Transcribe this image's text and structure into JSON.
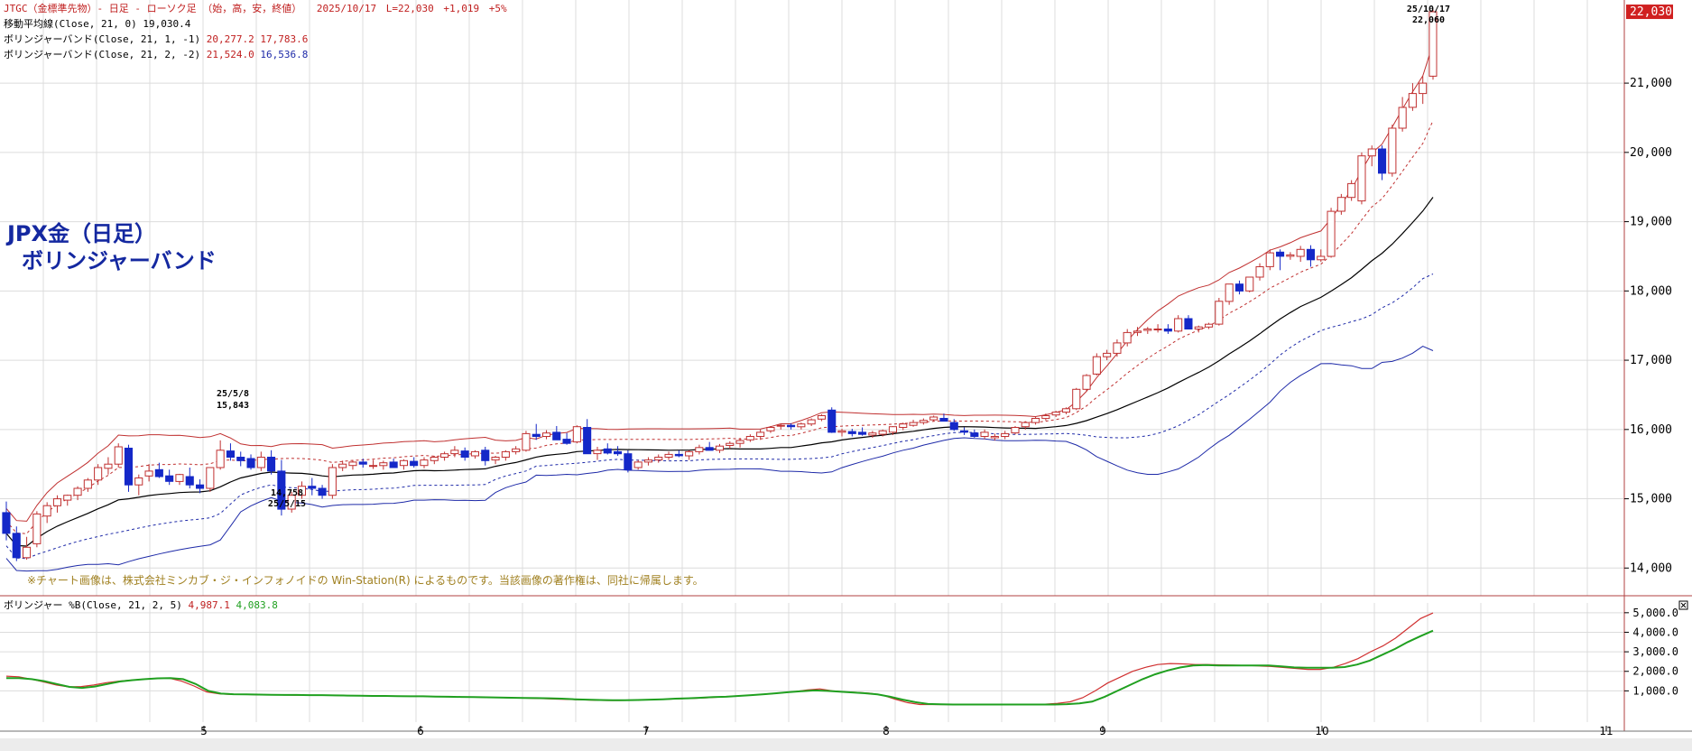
{
  "header": {
    "line1": {
      "symbol": "JTGC（金標準先物）- 日足 - ローソク足 （始，高，安，終値）",
      "date": "2025/10/17",
      "last": "L=22,030",
      "change": "+1,019",
      "limit": "+5%"
    },
    "line2": {
      "label": "移動平均線(Close, 21, 0)",
      "value": "19,030.4"
    },
    "line3": {
      "label": "ボリンジャーバンド(Close, 21, 1, -1)",
      "upper": "20,277.2",
      "lower": "17,783.6"
    },
    "line4": {
      "label": "ボリンジャーバンド(Close, 21, 2, -2)",
      "upper": "21,524.0",
      "lower": "16,536.8"
    }
  },
  "title_line1": "JPX金（日足）",
  "title_line2": "ボリンジャーバンド",
  "credit": "※チャート画像は、株式会社ミンカブ・ジ・インフォノイドの Win-Station(R) によるものです。当該画像の著作権は、同社に帰属します。",
  "colors": {
    "bull": "#c03030",
    "bear": "#1428c8",
    "ma": "#000000",
    "band1": "#c03030",
    "band2": "#1e2aa8",
    "pb_red": "#d03030",
    "pb_green": "#20a020",
    "last_price_bg": "#d02020",
    "grid": "#dcdcdc",
    "frame": "#b04040"
  },
  "chart_data": {
    "type": "candlestick",
    "y_axis": {
      "ticks": [
        "14,000",
        "15,000",
        "16,000",
        "17,000",
        "18,000",
        "19,000",
        "20,000",
        "21,000"
      ],
      "range": [
        13600,
        22200
      ],
      "last_price_label": "22,030"
    },
    "x_axis": {
      "ticks": [
        "5",
        "6",
        "7",
        "8",
        "9",
        "10",
        "11"
      ]
    },
    "annotations": [
      {
        "date": "25/5/8",
        "value": "15,843"
      },
      {
        "date": "25/5/15",
        "value": "14,758"
      },
      {
        "date": "25/10/17",
        "value": "22,060"
      }
    ],
    "candles": [
      [
        14800,
        14960,
        14400,
        14500
      ],
      [
        14500,
        14600,
        14100,
        14150
      ],
      [
        14150,
        14450,
        14120,
        14300
      ],
      [
        14350,
        14820,
        14300,
        14780
      ],
      [
        14750,
        14950,
        14650,
        14900
      ],
      [
        14900,
        15050,
        14800,
        15000
      ],
      [
        14980,
        15060,
        14900,
        15050
      ],
      [
        15050,
        15180,
        14980,
        15150
      ],
      [
        15150,
        15300,
        15100,
        15270
      ],
      [
        15270,
        15500,
        15200,
        15450
      ],
      [
        15440,
        15600,
        15350,
        15500
      ],
      [
        15500,
        15800,
        15450,
        15750
      ],
      [
        15730,
        15780,
        15100,
        15200
      ],
      [
        15200,
        15350,
        15050,
        15300
      ],
      [
        15330,
        15500,
        15250,
        15400
      ],
      [
        15420,
        15520,
        15300,
        15320
      ],
      [
        15330,
        15420,
        15200,
        15250
      ],
      [
        15250,
        15360,
        15200,
        15350
      ],
      [
        15320,
        15450,
        15150,
        15200
      ],
      [
        15200,
        15280,
        15080,
        15150
      ],
      [
        15150,
        15450,
        15100,
        15450
      ],
      [
        15450,
        15843,
        15420,
        15700
      ],
      [
        15690,
        15800,
        15550,
        15600
      ],
      [
        15600,
        15680,
        15470,
        15550
      ],
      [
        15580,
        15640,
        15420,
        15450
      ],
      [
        15450,
        15680,
        15400,
        15600
      ],
      [
        15600,
        15700,
        15350,
        15400
      ],
      [
        15400,
        15560,
        14758,
        14850
      ],
      [
        14850,
        15100,
        14800,
        15050
      ],
      [
        15050,
        15250,
        15000,
        15180
      ],
      [
        15180,
        15300,
        15050,
        15150
      ],
      [
        15150,
        15200,
        15000,
        15050
      ],
      [
        15050,
        15500,
        15000,
        15450
      ],
      [
        15450,
        15550,
        15400,
        15500
      ],
      [
        15480,
        15560,
        15420,
        15530
      ],
      [
        15530,
        15580,
        15450,
        15500
      ],
      [
        15470,
        15560,
        15430,
        15480
      ],
      [
        15480,
        15550,
        15420,
        15520
      ],
      [
        15530,
        15580,
        15450,
        15450
      ],
      [
        15480,
        15570,
        15420,
        15550
      ],
      [
        15540,
        15600,
        15450,
        15480
      ],
      [
        15480,
        15600,
        15440,
        15560
      ],
      [
        15550,
        15620,
        15500,
        15600
      ],
      [
        15600,
        15680,
        15550,
        15650
      ],
      [
        15650,
        15760,
        15600,
        15700
      ],
      [
        15690,
        15740,
        15550,
        15600
      ],
      [
        15620,
        15700,
        15580,
        15680
      ],
      [
        15700,
        15750,
        15480,
        15550
      ],
      [
        15560,
        15620,
        15500,
        15600
      ],
      [
        15600,
        15700,
        15550,
        15680
      ],
      [
        15680,
        15760,
        15640,
        15720
      ],
      [
        15700,
        15980,
        15680,
        15940
      ],
      [
        15930,
        16080,
        15850,
        15900
      ],
      [
        15900,
        15990,
        15860,
        15950
      ],
      [
        15960,
        16050,
        15850,
        15850
      ],
      [
        15860,
        15950,
        15780,
        15800
      ],
      [
        15820,
        16060,
        15800,
        16040
      ],
      [
        16030,
        16150,
        15650,
        15650
      ],
      [
        15650,
        15750,
        15560,
        15700
      ],
      [
        15720,
        15800,
        15640,
        15660
      ],
      [
        15680,
        15760,
        15620,
        15650
      ],
      [
        15650,
        15700,
        15380,
        15420
      ],
      [
        15450,
        15560,
        15420,
        15530
      ],
      [
        15530,
        15600,
        15480,
        15560
      ],
      [
        15560,
        15640,
        15520,
        15600
      ],
      [
        15600,
        15680,
        15560,
        15640
      ],
      [
        15640,
        15700,
        15600,
        15620
      ],
      [
        15620,
        15700,
        15560,
        15680
      ],
      [
        15680,
        15780,
        15640,
        15740
      ],
      [
        15740,
        15820,
        15700,
        15700
      ],
      [
        15700,
        15790,
        15660,
        15760
      ],
      [
        15770,
        15830,
        15720,
        15800
      ],
      [
        15800,
        15880,
        15740,
        15840
      ],
      [
        15850,
        15930,
        15820,
        15900
      ],
      [
        15900,
        16000,
        15850,
        15960
      ],
      [
        15980,
        16050,
        15950,
        16030
      ],
      [
        16050,
        16080,
        16000,
        16060
      ],
      [
        16060,
        16090,
        16000,
        16040
      ],
      [
        16040,
        16100,
        16000,
        16080
      ],
      [
        16080,
        16160,
        16050,
        16140
      ],
      [
        16150,
        16220,
        16120,
        16200
      ],
      [
        16280,
        16320,
        15950,
        15960
      ],
      [
        15960,
        16010,
        15900,
        15980
      ],
      [
        15970,
        16010,
        15900,
        15940
      ],
      [
        15960,
        16030,
        15910,
        15930
      ],
      [
        15920,
        15980,
        15880,
        15950
      ],
      [
        15930,
        16000,
        15900,
        15980
      ],
      [
        15960,
        16050,
        15920,
        16040
      ],
      [
        16030,
        16100,
        15990,
        16080
      ],
      [
        16060,
        16140,
        16040,
        16100
      ],
      [
        16100,
        16160,
        16070,
        16130
      ],
      [
        16140,
        16200,
        16120,
        16180
      ],
      [
        16160,
        16230,
        16130,
        16120
      ],
      [
        16100,
        16150,
        15980,
        16000
      ],
      [
        15980,
        16030,
        15920,
        15960
      ],
      [
        15950,
        16000,
        15880,
        15900
      ],
      [
        15900,
        16000,
        15860,
        15960
      ],
      [
        15880,
        15940,
        15840,
        15900
      ],
      [
        15900,
        15980,
        15860,
        15940
      ],
      [
        15950,
        16050,
        15930,
        16030
      ],
      [
        16040,
        16120,
        16000,
        16100
      ],
      [
        16100,
        16180,
        16070,
        16160
      ],
      [
        16160,
        16230,
        16130,
        16200
      ],
      [
        16210,
        16270,
        16180,
        16250
      ],
      [
        16250,
        16320,
        16220,
        16300
      ],
      [
        16300,
        16600,
        16280,
        16580
      ],
      [
        16580,
        16800,
        16550,
        16780
      ],
      [
        16800,
        17100,
        16780,
        17050
      ],
      [
        17050,
        17150,
        17000,
        17100
      ],
      [
        17100,
        17300,
        17050,
        17250
      ],
      [
        17250,
        17450,
        17200,
        17400
      ],
      [
        17400,
        17480,
        17350,
        17420
      ],
      [
        17430,
        17480,
        17380,
        17450
      ],
      [
        17450,
        17520,
        17400,
        17450
      ],
      [
        17450,
        17520,
        17380,
        17420
      ],
      [
        17420,
        17650,
        17400,
        17600
      ],
      [
        17600,
        17650,
        17450,
        17450
      ],
      [
        17450,
        17500,
        17400,
        17480
      ],
      [
        17480,
        17540,
        17450,
        17520
      ],
      [
        17520,
        17900,
        17500,
        17850
      ],
      [
        17850,
        18100,
        17800,
        18100
      ],
      [
        18100,
        18150,
        17950,
        18000
      ],
      [
        18000,
        18200,
        17980,
        18200
      ],
      [
        18200,
        18400,
        18150,
        18350
      ],
      [
        18350,
        18600,
        18300,
        18550
      ],
      [
        18560,
        18600,
        18300,
        18500
      ],
      [
        18500,
        18560,
        18450,
        18520
      ],
      [
        18500,
        18650,
        18420,
        18600
      ],
      [
        18600,
        18660,
        18350,
        18450
      ],
      [
        18450,
        18600,
        18420,
        18500
      ],
      [
        18500,
        19200,
        18480,
        19150
      ],
      [
        19150,
        19400,
        19100,
        19350
      ],
      [
        19350,
        19600,
        19300,
        19550
      ],
      [
        19300,
        20000,
        19250,
        19950
      ],
      [
        19950,
        20100,
        19800,
        20050
      ],
      [
        20050,
        20100,
        19600,
        19700
      ],
      [
        19700,
        20400,
        19650,
        20350
      ],
      [
        20350,
        20800,
        20300,
        20650
      ],
      [
        20650,
        21000,
        20600,
        20850
      ],
      [
        20850,
        21100,
        20700,
        21000
      ],
      [
        21100,
        22060,
        21050,
        22030
      ]
    ],
    "series": [
      {
        "name": "移動平均線(Close, 21, 0)",
        "last": "19,030.4"
      },
      {
        "name": "ボリンジャーバンド(Close, 21, 1, -1)",
        "upper": "20,277.2",
        "lower": "17,783.6"
      },
      {
        "name": "ボリンジャーバンド(Close, 21, 2, -2)",
        "upper": "21,524.0",
        "lower": "16,536.8"
      }
    ],
    "lower_panel": {
      "label": "ボリンジャー %B(Close, 21, 2, 5)",
      "value1": "4,987.1",
      "value2": "4,083.8",
      "y_ticks": [
        "1,000.0",
        "2,000.0",
        "3,000.0",
        "4,000.0",
        "5,000.0"
      ],
      "range": [
        -600,
        5500
      ],
      "red": [
        1750,
        1720,
        1600,
        1450,
        1300,
        1200,
        1220,
        1300,
        1420,
        1500,
        1550,
        1600,
        1640,
        1650,
        1500,
        1250,
        950,
        850,
        820,
        820,
        800,
        800,
        790,
        780,
        780,
        770,
        770,
        760,
        760,
        750,
        740,
        730,
        720,
        720,
        710,
        700,
        690,
        680,
        670,
        660,
        650,
        640,
        620,
        600,
        580,
        560,
        540,
        520,
        510,
        510,
        520,
        540,
        560,
        580,
        600,
        620,
        650,
        680,
        720,
        760,
        800,
        840,
        900,
        960,
        1050,
        1100,
        1000,
        950,
        920,
        880,
        780,
        580,
        400,
        300,
        300,
        300,
        300,
        300,
        300,
        300,
        300,
        300,
        300,
        320,
        360,
        440,
        650,
        1000,
        1400,
        1700,
        2000,
        2200,
        2350,
        2400,
        2380,
        2350,
        2350,
        2330,
        2320,
        2300,
        2280,
        2250,
        2200,
        2150,
        2100,
        2100,
        2200,
        2400,
        2650,
        3000,
        3300,
        3700,
        4200,
        4700,
        4987
      ],
      "green": [
        1650,
        1650,
        1600,
        1500,
        1350,
        1200,
        1150,
        1220,
        1350,
        1480,
        1550,
        1600,
        1640,
        1650,
        1600,
        1350,
        1000,
        860,
        830,
        820,
        810,
        800,
        790,
        790,
        780,
        780,
        770,
        760,
        750,
        740,
        740,
        730,
        720,
        720,
        710,
        700,
        690,
        680,
        670,
        660,
        650,
        640,
        630,
        620,
        600,
        570,
        550,
        530,
        520,
        520,
        530,
        550,
        570,
        600,
        620,
        650,
        680,
        700,
        740,
        780,
        830,
        880,
        940,
        980,
        1020,
        1000,
        960,
        920,
        880,
        820,
        700,
        550,
        420,
        330,
        310,
        300,
        300,
        300,
        300,
        300,
        300,
        300,
        300,
        300,
        320,
        360,
        450,
        700,
        1000,
        1300,
        1600,
        1850,
        2050,
        2200,
        2300,
        2320,
        2300,
        2300,
        2300,
        2300,
        2300,
        2250,
        2200,
        2180,
        2180,
        2180,
        2220,
        2350,
        2550,
        2850,
        3150,
        3500,
        3800,
        4083
      ]
    }
  }
}
